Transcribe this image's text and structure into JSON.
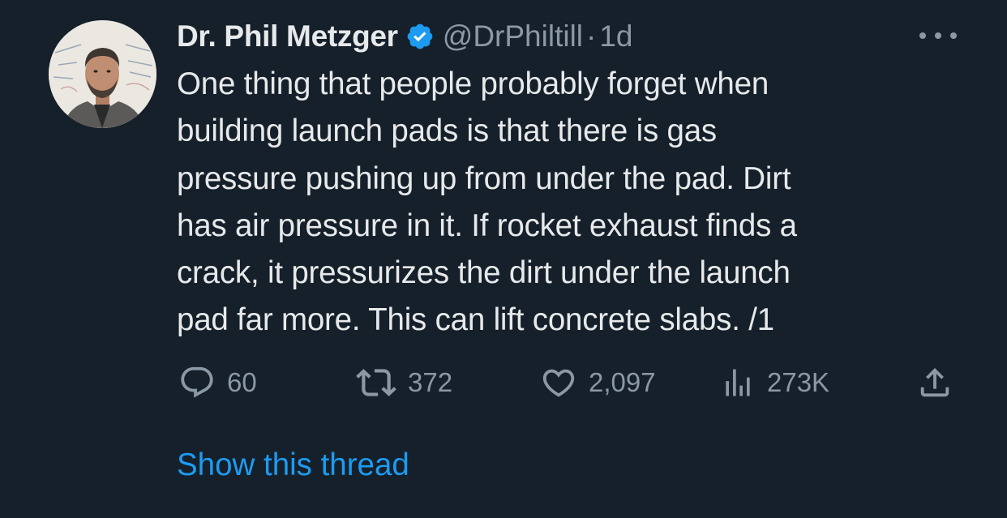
{
  "author": {
    "display_name": "Dr. Phil Metzger",
    "handle": "@DrPhiltill",
    "separator": "·",
    "time": "1d",
    "verified": true
  },
  "tweet": {
    "lines": [
      "One thing that people probably forget when",
      "building launch pads is that there is gas",
      "pressure pushing up from under the pad. Dirt",
      "has air pressure in it. If rocket exhaust finds a",
      "crack, it pressurizes the dirt under the launch",
      "pad far more. This can lift concrete slabs. /1"
    ]
  },
  "actions": {
    "replies": "60",
    "retweets": "372",
    "likes": "2,097",
    "views": "273K"
  },
  "show_thread_label": "Show this thread",
  "icons": {
    "verified": "verified-badge-icon",
    "more": "more-icon",
    "reply": "reply-icon",
    "retweet": "retweet-icon",
    "like": "heart-icon",
    "views": "views-icon",
    "share": "share-icon"
  },
  "colors": {
    "background": "#15202b",
    "text": "#e7e9ea",
    "secondary": "#8b98a5",
    "accent": "#1d9bf0"
  }
}
